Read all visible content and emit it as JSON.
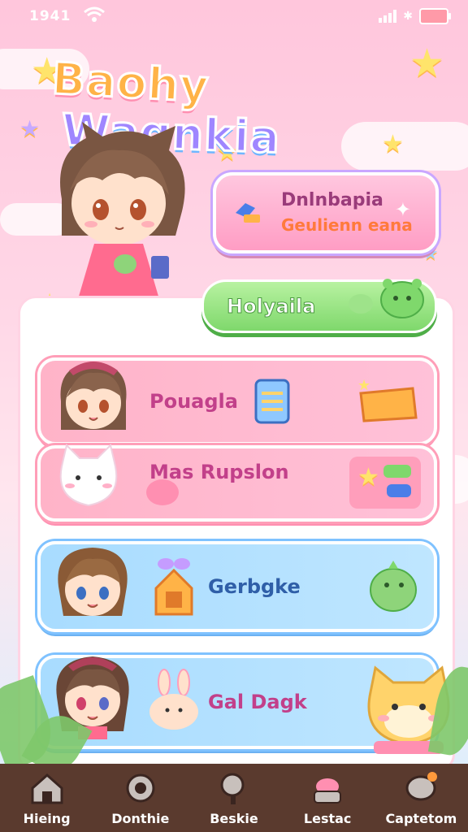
{
  "status": {
    "time": "1941"
  },
  "title": {
    "part1": "Baohy",
    "part2": "Wagnkia"
  },
  "hero_button": {
    "line1": "Dnlnbapia",
    "line2": "Geulienn eana",
    "icon": "wand-icon"
  },
  "green_button": {
    "label": "Holyaila",
    "icon": "slime-icon"
  },
  "cards": [
    {
      "label": "Pouagla",
      "icon": "notepad-icon",
      "extra": "folder-icon"
    },
    {
      "label": "Mas Rupslon",
      "icon": "cat-icon",
      "extra": "gems-icon"
    },
    {
      "label": "Gerbgke",
      "icon": "house-icon",
      "extra": "dino-icon"
    },
    {
      "label": "Gal Dagk",
      "icon": "bunny-icon",
      "extra": "shiba-icon"
    }
  ],
  "nav": [
    {
      "label": "Hieing",
      "icon": "home-icon"
    },
    {
      "label": "Donthie",
      "icon": "gear-icon"
    },
    {
      "label": "Beskie",
      "icon": "search-icon"
    },
    {
      "label": "Lestac",
      "icon": "pet-bowl-icon"
    },
    {
      "label": "Captetom",
      "icon": "chat-icon"
    }
  ],
  "colors": {
    "pink": "#ff9dc4",
    "green": "#7fd86c",
    "blue": "#a8dcff",
    "nav": "#5a3a2e"
  }
}
